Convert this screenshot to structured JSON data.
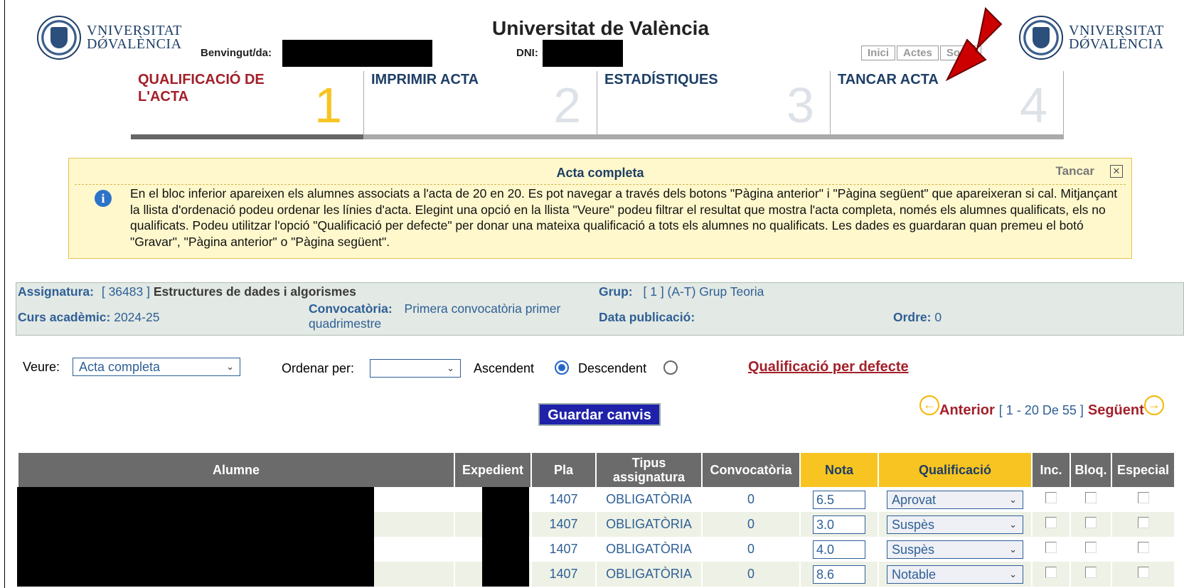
{
  "header": {
    "university_line1": "VNIVERSITAT",
    "university_line2": "DǾVALÈNCIA",
    "title": "Universitat de València",
    "welcome_label": "Benvingut/da:",
    "dni_label": "DNI:",
    "nav": [
      "Inici",
      "Actes",
      "Sortir"
    ]
  },
  "steps": [
    {
      "label": "QUALIFICACIÓ DE L'ACTA",
      "number": "1",
      "active": true
    },
    {
      "label": "IMPRIMIR ACTA",
      "number": "2",
      "active": false
    },
    {
      "label": "ESTADÍSTIQUES",
      "number": "3",
      "active": false
    },
    {
      "label": "TANCAR ACTA",
      "number": "4",
      "active": false
    }
  ],
  "info": {
    "title": "Acta completa",
    "close_label": "Tancar",
    "text": "En el bloc inferior apareixen els alumnes associats a l'acta de 20 en 20. Es pot navegar a través dels botons \"Pàgina anterior\" i \"Pàgina següent\" que apareixeran si cal. Mitjançant la llista d'ordenació podeu ordenar les línies d'acta. Elegint una opció en la llista \"Veure\" podeu filtrar el resultat que mostra l'acta completa, només els alumnes qualificats, els no qualificats. Podeu utilitzar l'opció \"Qualificació per defecte\" per donar una mateixa qualificació a tots els alumnes no qualificats. Les dades es guardaran quan premeu el botó \"Gravar\", \"Pàgina anterior\" o \"Pàgina següent\"."
  },
  "course": {
    "subject_label": "Assignatura:",
    "subject_code": "[ 36483 ]",
    "subject_name": "Estructures de dades i algorismes",
    "group_label": "Grup:",
    "group_value": "[ 1 ] (A-T) Grup Teoria",
    "year_label": "Curs acadèmic:",
    "year_value": "2024-25",
    "call_label": "Convocatòria:",
    "call_value_1": "Primera convocatòria primer",
    "call_value_2": "quadrimestre",
    "pubdate_label": "Data publicació:",
    "order_label": "Ordre:",
    "order_value": "0"
  },
  "filters": {
    "view_label": "Veure:",
    "view_value": "Acta completa",
    "sort_label": "Ordenar per:",
    "sort_value": "",
    "asc_label": "Ascendent",
    "desc_label": "Descendent",
    "selected_order": "Ascendent",
    "default_grade_link": "Qualificació per defecte"
  },
  "actions": {
    "save_label": "Guardar canvis"
  },
  "pager": {
    "prev_label": "Anterior",
    "range": "[ 1 - 20 De 55 ]",
    "next_label": "Següent"
  },
  "table": {
    "headers": [
      "Alumne",
      "Expedient",
      "Pla",
      "Tipus assignatura",
      "Convocatòria",
      "Nota",
      "Qualificació",
      "Inc.",
      "Bloq.",
      "Especial"
    ],
    "rows": [
      {
        "pla": "1407",
        "tipus": "OBLIGATÒRIA",
        "conv": "0",
        "nota": "6.5",
        "qual": "Aprovat"
      },
      {
        "pla": "1407",
        "tipus": "OBLIGATÒRIA",
        "conv": "0",
        "nota": "3.0",
        "qual": "Suspès"
      },
      {
        "pla": "1407",
        "tipus": "OBLIGATÒRIA",
        "conv": "0",
        "nota": "4.0",
        "qual": "Suspès"
      },
      {
        "pla": "1407",
        "tipus": "OBLIGATÒRIA",
        "conv": "0",
        "nota": "8.6",
        "qual": "Notable"
      }
    ]
  },
  "colors": {
    "accent_red": "#a3202a",
    "navy": "#1e3e66",
    "link_blue": "#2e5f96",
    "yellow": "#f7c421",
    "arrow_red": "#cc0000"
  }
}
